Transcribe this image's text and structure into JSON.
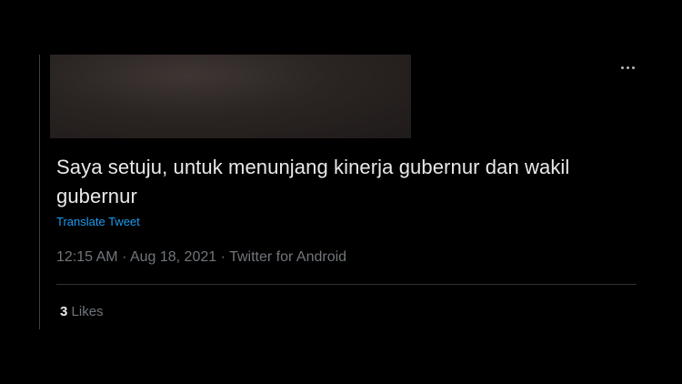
{
  "tweet": {
    "text": "Saya setuju, untuk menunjang kinerja gubernur dan wakil gubernur",
    "translate_label": "Translate Tweet",
    "time": "12:15 AM",
    "date": "Aug 18, 2021",
    "source": "Twitter for Android",
    "separator": " · ",
    "likes_count": "3",
    "likes_label": "Likes"
  },
  "icons": {
    "more": "more-horizontal-icon"
  },
  "colors": {
    "background": "#000000",
    "text_primary": "#e7e9ea",
    "text_secondary": "#71767b",
    "link": "#1d9bf0",
    "divider": "#2f3336"
  }
}
